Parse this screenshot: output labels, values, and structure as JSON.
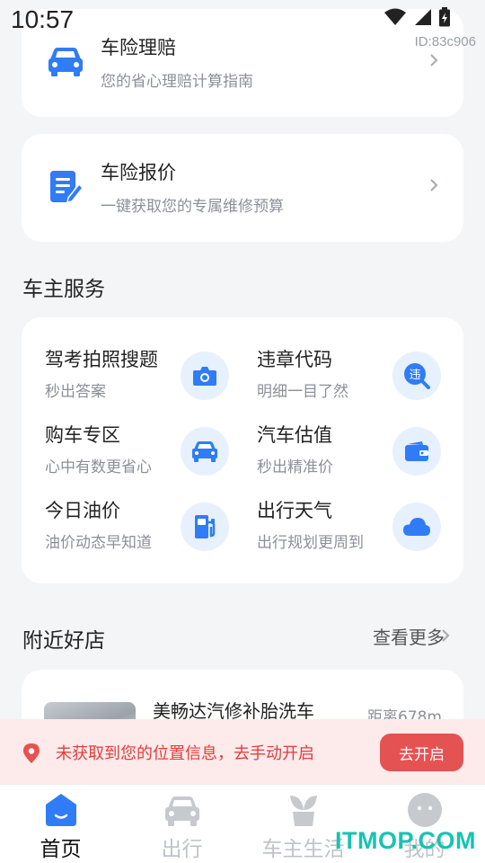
{
  "status_bar": {
    "time": "10:57",
    "app_id": "ID:83c906"
  },
  "menu_cards": [
    {
      "title": "车险理赔",
      "desc": "您的省心理赔计算指南",
      "icon": "car-icon"
    },
    {
      "title": "车险报价",
      "desc": "一键获取您的专属维修预算",
      "icon": "document-edit-icon"
    }
  ],
  "services": {
    "title": "车主服务",
    "items": [
      {
        "name": "驾考拍照搜题",
        "desc": "秒出答案",
        "icon": "camera-icon"
      },
      {
        "name": "违章代码",
        "desc": "明细一目了然",
        "icon": "violation-search-icon",
        "icon_text": "违"
      },
      {
        "name": "购车专区",
        "desc": "心中有数更省心",
        "icon": "car-icon"
      },
      {
        "name": "汽车估值",
        "desc": "秒出精准价",
        "icon": "wallet-icon"
      },
      {
        "name": "今日油价",
        "desc": "油价动态早知道",
        "icon": "fuel-pump-icon"
      },
      {
        "name": "出行天气",
        "desc": "出行规划更周到",
        "icon": "cloud-icon"
      }
    ]
  },
  "nearby": {
    "title": "附近好店",
    "more_label": "查看更多",
    "shops": [
      {
        "name": "美畅达汽修补胎洗车",
        "distance": "距离678m"
      }
    ]
  },
  "location_banner": {
    "text": "未获取到您的位置信息，去手动开启",
    "button_label": "去开启"
  },
  "tabs": [
    {
      "label": "首页",
      "icon": "home-icon",
      "active": true
    },
    {
      "label": "出行",
      "icon": "car-icon",
      "active": false
    },
    {
      "label": "车主生活",
      "icon": "sprout-icon",
      "active": false
    },
    {
      "label": "我的",
      "icon": "profile-icon",
      "active": false
    }
  ],
  "watermark": "ITMOP.COM",
  "colors": {
    "accent": "#2f7cf6",
    "icon_bg": "#e7f1fd",
    "danger": "#e55252",
    "danger_bg": "#fdeaea",
    "background": "#f4f5f7"
  }
}
